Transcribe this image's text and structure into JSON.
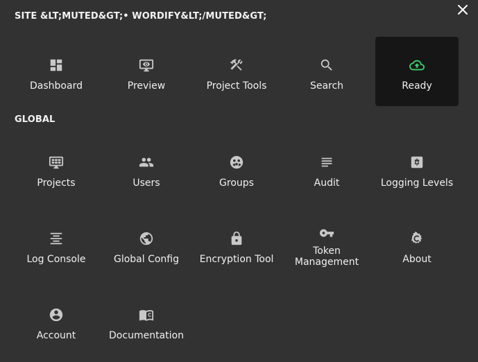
{
  "site_title": "SITE &LT;MUTED&GT;• WORDIFY&LT;/MUTED&GT;",
  "close_label": "×",
  "site_tools": [
    {
      "label": "Dashboard",
      "icon": "dashboard-icon"
    },
    {
      "label": "Preview",
      "icon": "preview-icon"
    },
    {
      "label": "Project Tools",
      "icon": "tools-icon"
    },
    {
      "label": "Search",
      "icon": "search-icon"
    },
    {
      "label": "Ready",
      "icon": "cloud-upload-icon",
      "active": true,
      "icon_color": "#3fcf6a"
    }
  ],
  "global_title": "GLOBAL",
  "global_tools": [
    {
      "label": "Projects",
      "icon": "projects-icon"
    },
    {
      "label": "Users",
      "icon": "users-icon"
    },
    {
      "label": "Groups",
      "icon": "groups-icon"
    },
    {
      "label": "Audit",
      "icon": "audit-icon"
    },
    {
      "label": "Logging Levels",
      "icon": "logging-levels-icon"
    },
    {
      "label": "Log Console",
      "icon": "log-console-icon"
    },
    {
      "label": "Global Config",
      "icon": "globe-icon"
    },
    {
      "label": "Encryption Tool",
      "icon": "lock-icon"
    },
    {
      "label": "Token\nManagement",
      "icon": "key-icon"
    },
    {
      "label": "About",
      "icon": "crafter-logo-icon"
    },
    {
      "label": "Account",
      "icon": "account-icon"
    },
    {
      "label": "Documentation",
      "icon": "documentation-icon"
    }
  ],
  "colors": {
    "background": "#323232",
    "active_tile": "#161616",
    "icon": "#c8c8c8",
    "ready_icon": "#3fcf6a"
  }
}
